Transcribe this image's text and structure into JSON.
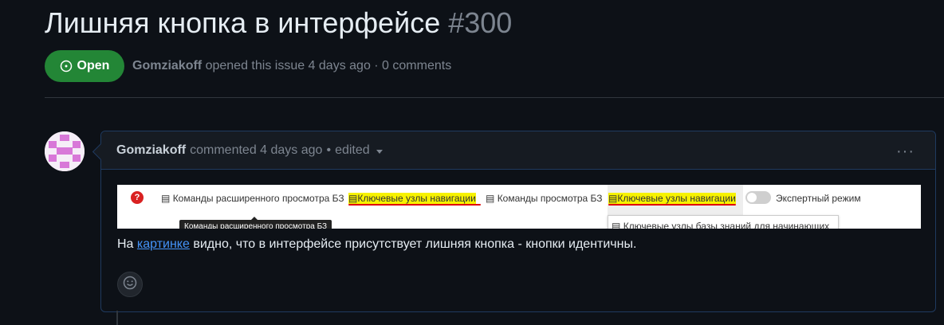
{
  "issue": {
    "title": "Лишняя кнопка в интерфейсе",
    "number": "#300",
    "state": "Open",
    "author": "Gomziakoff",
    "meta_text": "opened this issue 4 days ago · 0 comments"
  },
  "comment": {
    "author": "Gomziakoff",
    "action": "commented 4 days ago",
    "separator": "•",
    "edited": "edited",
    "menu": "···",
    "body_before": "На ",
    "link_text": "картинке",
    "body_after": " видно, что в интерфейсе присутствует лишняя кнопка - кнопки идентичны."
  },
  "screenshot": {
    "help": "?",
    "item1": "Команды расширенного просмотра БЗ",
    "item2": "Ключевые узлы навигации",
    "item3": "Команды просмотра БЗ",
    "item4": "Ключевые узлы навигации",
    "expert_mode": "Экспертный режим",
    "tooltip": "Команды расширенного просмотра БЗ",
    "dropdown_item": "Ключевые узлы базы знаний для начинающих"
  },
  "colors": {
    "open_badge": "#238636",
    "link": "#4493f8",
    "highlight": "#f7f200",
    "underline": "#e00000"
  },
  "icons": [
    "issue-opened-icon",
    "caret-down-icon",
    "kebab-icon",
    "help-icon",
    "doc-icon",
    "smiley-icon"
  ]
}
